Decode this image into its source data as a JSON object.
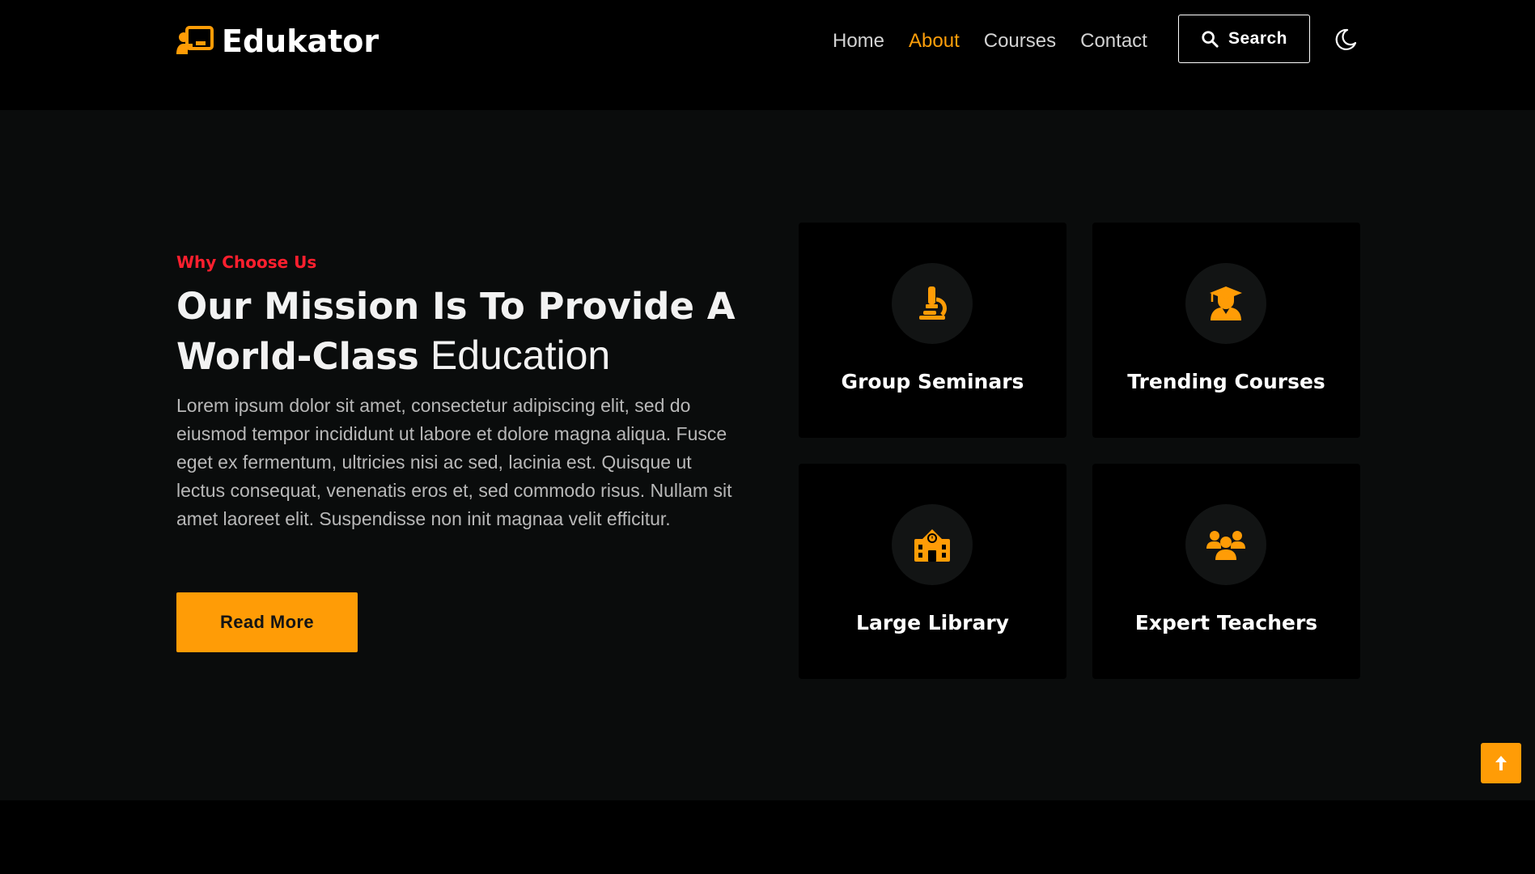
{
  "colors": {
    "accent": "#ff9c06",
    "eyebrow": "#ff1f2e",
    "background": "#000000",
    "section_background": "#0a0c0c",
    "card_background": "#000000"
  },
  "header": {
    "logo": {
      "text": "Edukator",
      "icon": "chalkboard-teacher-icon"
    },
    "nav": [
      {
        "label": "Home",
        "active": false
      },
      {
        "label": "About",
        "active": true
      },
      {
        "label": "Courses",
        "active": false
      },
      {
        "label": "Contact",
        "active": false
      }
    ],
    "search": {
      "label": "Search",
      "icon": "search-icon"
    },
    "theme_toggle": {
      "icon": "moon-icon"
    }
  },
  "about": {
    "eyebrow": "Why Choose Us",
    "title_bold": "Our Mission Is To Provide A World-Class",
    "title_light": "Education",
    "description": "Lorem ipsum dolor sit amet, consectetur adipiscing elit, sed do eiusmod tempor incididunt ut labore et dolore magna aliqua. Fusce eget ex fermentum, ultricies nisi ac sed, lacinia est. Quisque ut lectus consequat, venenatis eros et, sed commodo risus. Nullam sit amet laoreet elit. Suspendisse non init magnaa velit efficitur.",
    "button_label": "Read More"
  },
  "features": [
    {
      "title": "Group Seminars",
      "icon": "microscope-icon"
    },
    {
      "title": "Trending Courses",
      "icon": "graduate-icon"
    },
    {
      "title": "Large Library",
      "icon": "school-building-icon"
    },
    {
      "title": "Expert Teachers",
      "icon": "users-group-icon"
    }
  ],
  "back_to_top": {
    "icon": "arrow-up-icon"
  }
}
